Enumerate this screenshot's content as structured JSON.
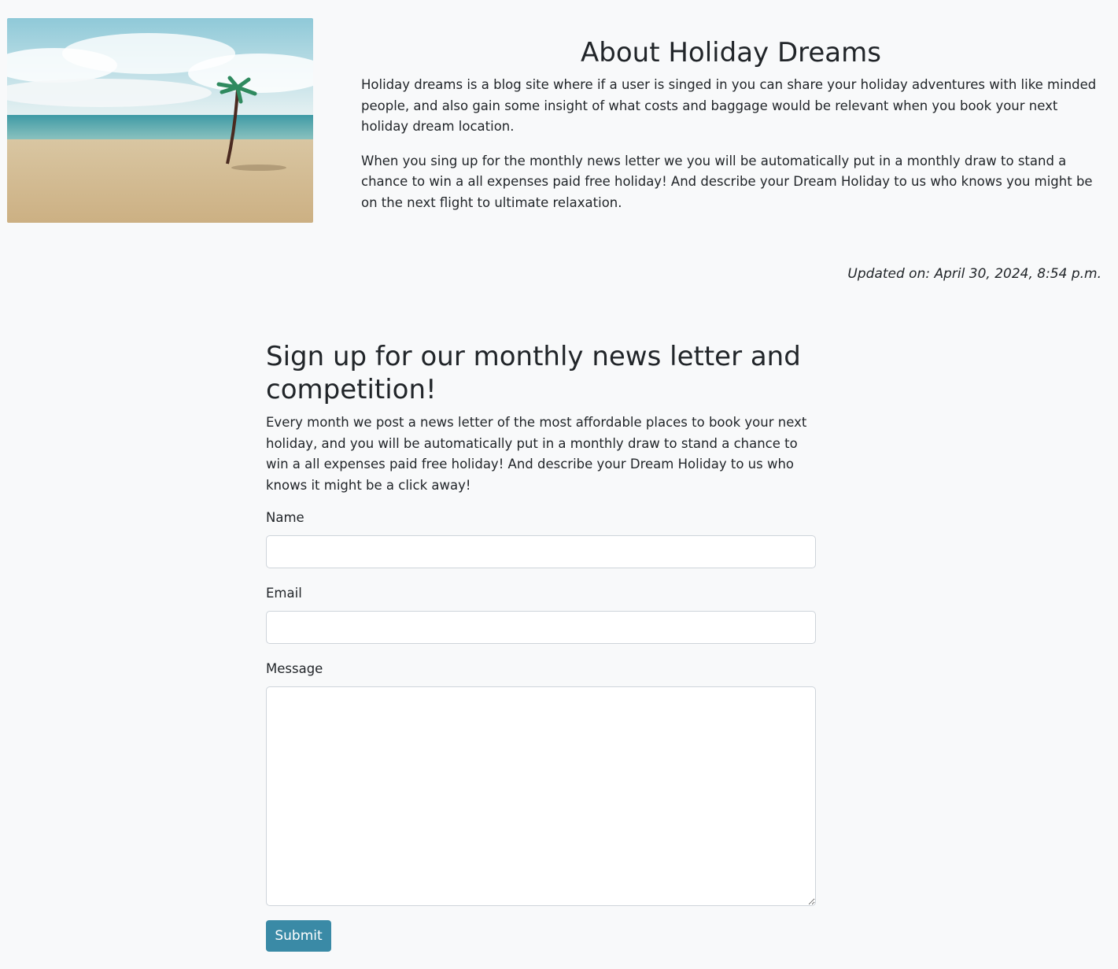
{
  "about": {
    "image_alt": "beach-with-palm-tree",
    "title": "About Holiday Dreams",
    "paragraphs": [
      "Holiday dreams is a blog site where if a user is singed in you can share your holiday adventures with like minded people, and also gain some insight of what costs and baggage would be relevant when you book your next holiday dream location.",
      "When you sing up for the monthly news letter we you will be automatically put in a monthly draw to stand a chance to win a all expenses paid free holiday! And describe your Dream Holiday to us who knows you might be on the next flight to ultimate relaxation."
    ],
    "updated": "Updated on: April 30, 2024, 8:54 p.m."
  },
  "signup": {
    "title": "Sign up for our monthly news letter and competition!",
    "description": "Every month we post a news letter of the most affordable places to book your next holiday, and you will be automatically put in a monthly draw to stand a chance to win a all expenses paid free holiday! And describe your Dream Holiday to us who knows it might be a click away!",
    "fields": {
      "name_label": "Name",
      "name_value": "",
      "email_label": "Email",
      "email_value": "",
      "message_label": "Message",
      "message_value": ""
    },
    "submit_label": "Submit"
  },
  "colors": {
    "background": "#f8f9fa",
    "text": "#212529",
    "button": "#3a8aa6",
    "input_border": "#ced4da"
  }
}
